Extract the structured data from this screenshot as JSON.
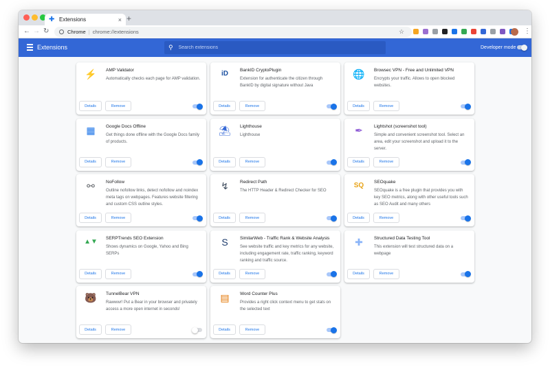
{
  "browser": {
    "tab_title": "Extensions",
    "tab_close": "×",
    "new_tab": "+",
    "url_scheme": "Chrome",
    "url_separator": "|",
    "url_path": "chrome://extensions",
    "toolbar_icons": [
      "#f6a623",
      "#9b6fd1",
      "#9aa0a6",
      "#202124",
      "#1a73e8",
      "#34a853",
      "#ea4335",
      "#3367d6",
      "#9aa0a6",
      "#7e57c2",
      "#1a73e8"
    ]
  },
  "header": {
    "title": "Extensions",
    "search_placeholder": "Search extensions",
    "developer_mode_label": "Developer mode"
  },
  "buttons": {
    "details": "Details",
    "remove": "Remove"
  },
  "extensions": [
    {
      "name": "AMP Validator",
      "description": "Automatically checks each page for AMP validation.",
      "icon": "lightning-icon",
      "glyph": "⚡",
      "color": "#202124",
      "enabled": true
    },
    {
      "name": "BankID CryptoPlugin",
      "description": "Extension for authenticate the citizen through BankID by digital signature without Java",
      "icon": "bankid-icon",
      "glyph": "iD",
      "color": "#1a4fa0",
      "enabled": true
    },
    {
      "name": "Browsec VPN - Free and Unlimited VPN",
      "description": "Encrypts your traffic. Allows to open blocked websites.",
      "icon": "globe-icon",
      "glyph": "🌐",
      "color": "#2e7d32",
      "enabled": true
    },
    {
      "name": "Google Docs Offline",
      "description": "Get things done offline with the Google Docs family of products.",
      "icon": "docs-icon",
      "glyph": "▦",
      "color": "#1a73e8",
      "enabled": true
    },
    {
      "name": "Lighthouse",
      "description": "Lighthouse",
      "icon": "lighthouse-icon",
      "glyph": "⛱",
      "color": "#3367d6",
      "enabled": true
    },
    {
      "name": "Lightshot (screenshot tool)",
      "description": "Simple and convenient screenshot tool. Select an area, edit your screenshot and upload it to the server.",
      "icon": "feather-icon",
      "glyph": "✒",
      "color": "#8e5bd6",
      "enabled": true
    },
    {
      "name": "NoFollow",
      "description": "Outline nofollow links, detect nofollow and noindex meta tags on webpages. Features website filtering and custom CSS outline styles.",
      "icon": "link-icon",
      "glyph": "⚯",
      "color": "#5f6368",
      "enabled": true
    },
    {
      "name": "Redirect Path",
      "description": "The HTTP Header & Redirect Checker for SEO",
      "icon": "redirect-icon",
      "glyph": "↯",
      "color": "#3c4a5c",
      "enabled": true
    },
    {
      "name": "SEOquake",
      "description": "SEOquake is a free plugin that provides you with key SEO metrics, along with other useful tools such as SEO Audit and many others",
      "icon": "seoquake-icon",
      "glyph": "SQ",
      "color": "#e8a317",
      "enabled": true
    },
    {
      "name": "SERPTrends SEO Extension",
      "description": "Shows dynamics on Google, Yahoo and Bing SERPs",
      "icon": "trends-icon",
      "glyph": "▲▼",
      "color": "#34a853",
      "enabled": true
    },
    {
      "name": "SimilarWeb - Traffic Rank & Website Analysis",
      "description": "See website traffic and key metrics for any website, including engagement rate, traffic ranking, keyword ranking and traffic source.",
      "icon": "similarweb-icon",
      "glyph": "S",
      "color": "#1b3a6b",
      "enabled": true
    },
    {
      "name": "Structured Data Testing Tool",
      "description": "This extension will test structured data on a webpage",
      "icon": "puzzle-icon",
      "glyph": "✚",
      "color": "#8ab4f8",
      "enabled": true
    },
    {
      "name": "TunnelBear VPN",
      "description": "Rawwwr! Put a Bear in your browser and privately access a more open internet in seconds!",
      "icon": "bear-icon",
      "glyph": "🐻",
      "color": "#c78a2a",
      "enabled": false
    },
    {
      "name": "Word Counter Plus",
      "description": "Provides a right click context menu to get stats on the selected text",
      "icon": "counter-icon",
      "glyph": "▤",
      "color": "#e37400",
      "enabled": true
    }
  ]
}
